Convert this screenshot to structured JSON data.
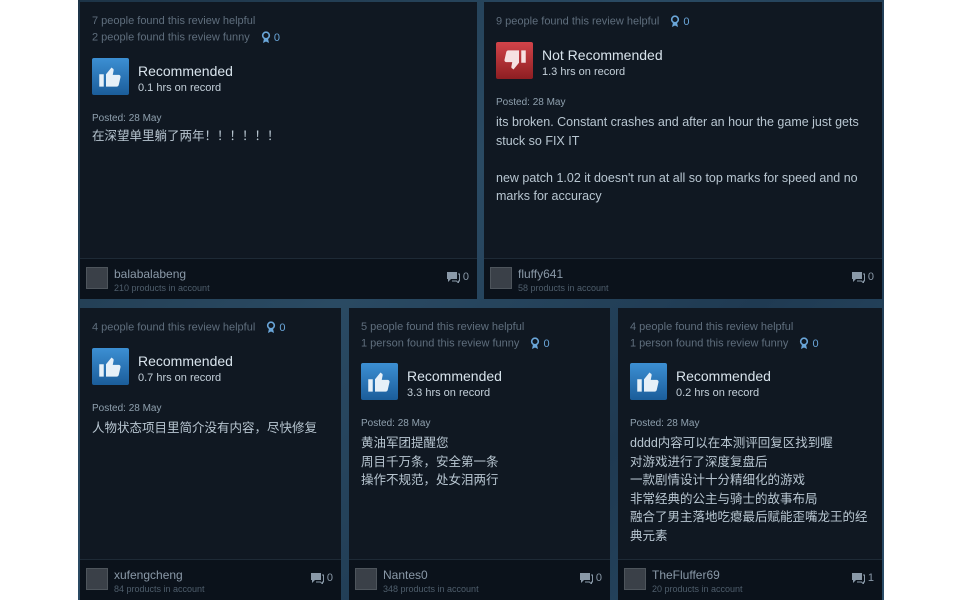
{
  "reviews": [
    {
      "helpful": "7 people found this review helpful",
      "funny": "2 people found this review funny",
      "awards": "0",
      "verdict": "Recommended",
      "hours": "0.1 hrs on record",
      "posted": "Posted: 28 May",
      "lines": [
        "在深望单里躺了两年！！！！！！"
      ],
      "username": "balabalabeng",
      "products": "210 products in account",
      "comments": "0"
    },
    {
      "helpful": "9 people found this review helpful",
      "awards": "0",
      "verdict": "Not Recommended",
      "hours": "1.3 hrs on record",
      "posted": "Posted: 28 May",
      "lines": [
        "its broken. Constant crashes and after an hour the game just gets stuck so FIX IT",
        "",
        "new patch 1.02 it doesn't run at all so top marks for speed and no marks for accuracy"
      ],
      "username": "fluffy641",
      "products": "58 products in account",
      "comments": "0"
    },
    {
      "helpful": "4 people found this review helpful",
      "awards": "0",
      "verdict": "Recommended",
      "hours": "0.7 hrs on record",
      "posted": "Posted: 28 May",
      "lines": [
        "人物状态项目里简介没有内容，尽快修复"
      ],
      "username": "xufengcheng",
      "products": "84 products in account",
      "comments": "0"
    },
    {
      "helpful": "5 people found this review helpful",
      "funny": "1 person found this review funny",
      "awards": "0",
      "verdict": "Recommended",
      "hours": "3.3 hrs on record",
      "posted": "Posted: 28 May",
      "lines": [
        "黄油军团提醒您",
        "周目千万条，安全第一条",
        "操作不规范，处女泪两行"
      ],
      "username": "Nantes0",
      "products": "348 products in account",
      "comments": "0"
    },
    {
      "helpful": "4 people found this review helpful",
      "funny": "1 person found this review funny",
      "awards": "0",
      "verdict": "Recommended",
      "hours": "0.2 hrs on record",
      "posted": "Posted: 28 May",
      "lines": [
        "dddd内容可以在本测评回复区找到喔",
        "对游戏进行了深度复盘后",
        "一款剧情设计十分精细化的游戏",
        "非常经典的公主与骑士的故事布局",
        "融合了男主落地吃瘪最后赋能歪嘴龙王的经典元素"
      ],
      "username": "TheFluffer69",
      "products": "20 products in account",
      "comments": "1"
    }
  ],
  "colors": {
    "recommended": "#2f7fc3",
    "not_recommended": "#c0363c",
    "card_bg": "#101822"
  },
  "icons": {
    "thumbs_up": "thumbs-up-icon",
    "thumbs_down": "thumbs-down-icon",
    "award": "award-icon",
    "comment": "comment-icon"
  }
}
